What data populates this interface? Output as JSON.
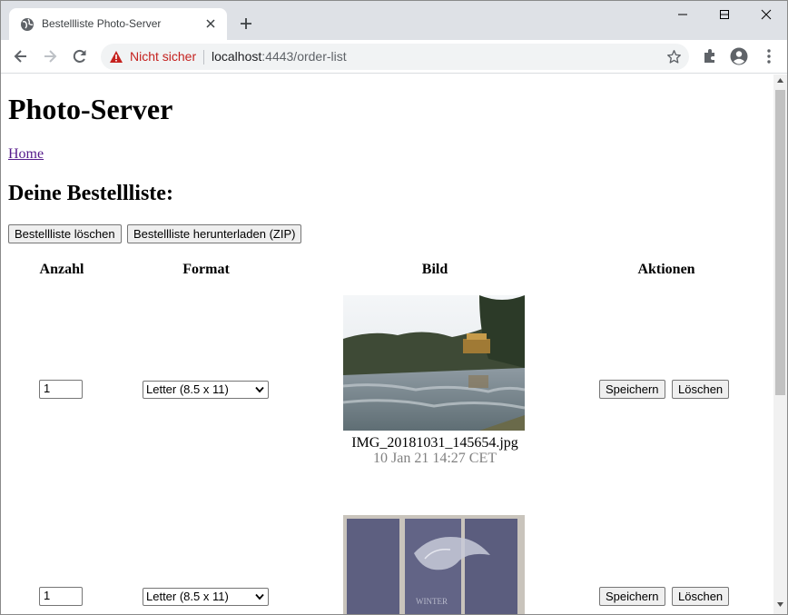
{
  "browser": {
    "tab_title": "Bestellliste Photo-Server",
    "security_label": "Nicht sicher",
    "url_host": "localhost",
    "url_rest": ":4443/order-list"
  },
  "page": {
    "title": "Photo-Server",
    "home_link": "Home",
    "heading": "Deine Bestellliste:",
    "clear_button": "Bestellliste löschen",
    "download_button": "Bestellliste herunterladen (ZIP)",
    "columns": [
      "Anzahl",
      "Format",
      "Bild",
      "Aktionen"
    ],
    "rows": [
      {
        "quantity": "1",
        "format": "Letter (8.5 x 11)",
        "filename": "IMG_20181031_145654.jpg",
        "date": "10 Jan 21 14:27 CET",
        "save_label": "Speichern",
        "delete_label": "Löschen"
      },
      {
        "quantity": "1",
        "format": "Letter (8.5 x 11)",
        "filename": "",
        "date": "",
        "save_label": "Speichern",
        "delete_label": "Löschen"
      }
    ]
  },
  "colors": {
    "tabstrip": "#dee1e6",
    "link_visited": "#551a8b",
    "warning": "#c5221f",
    "date_text": "#808080"
  }
}
